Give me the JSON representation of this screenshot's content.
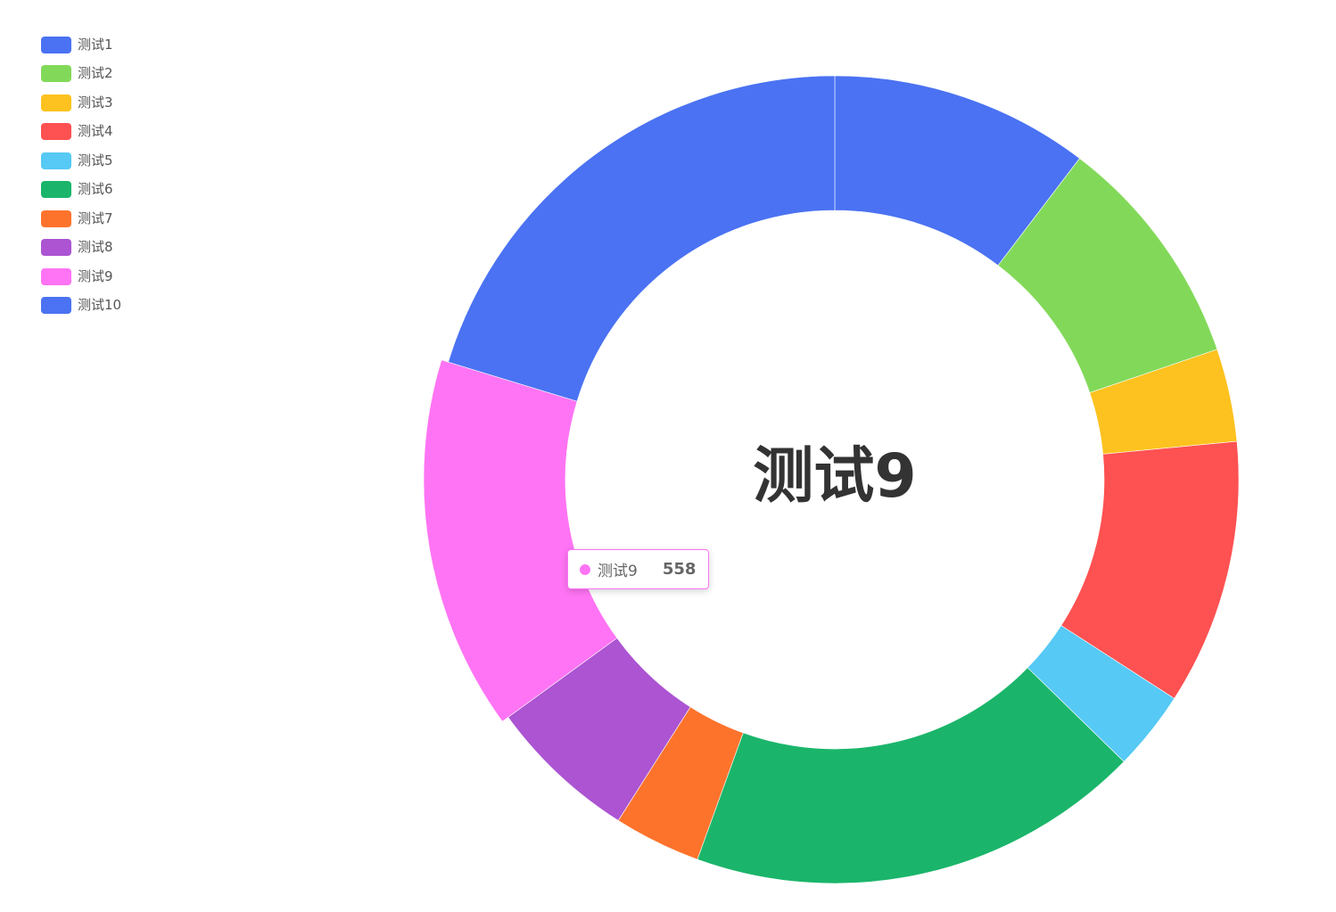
{
  "chart_data": {
    "type": "pie",
    "donut": true,
    "legend_position": "top-left",
    "categories": [
      "测试1",
      "测试2",
      "测试3",
      "测试4",
      "测试5",
      "测试6",
      "测试7",
      "测试8",
      "测试9",
      "测试10"
    ],
    "values": [
      393,
      357,
      141,
      403,
      121,
      691,
      132,
      227,
      558,
      770
    ],
    "colors": [
      "#4a72f2",
      "#82d959",
      "#fdc21f",
      "#fe5151",
      "#56c9f5",
      "#1ab56a",
      "#fe732c",
      "#ac54d2",
      "#ff74f4",
      "#4a72f2"
    ],
    "center_label": "测试9",
    "tooltip": {
      "name": "测试9",
      "value": "558",
      "color": "#ff74f4"
    }
  }
}
